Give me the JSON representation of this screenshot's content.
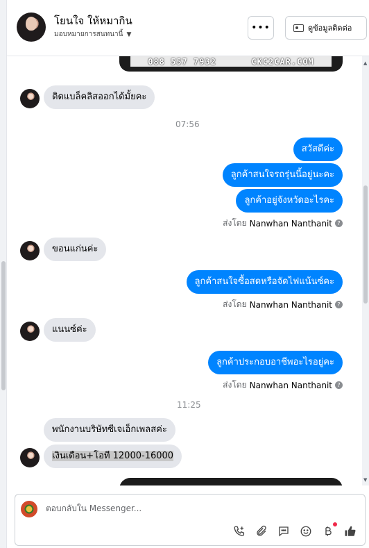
{
  "header": {
    "title": "โยนใจ ให้หมากิน",
    "subtitle": "มอบหมายการสนทนานี้",
    "more_label": "•••",
    "contact_label": "ดูข้อมูลติดต่อ"
  },
  "image_banner": {
    "phone": "088 557 7932",
    "site": "CKC2CAR.COM"
  },
  "messages": [
    {
      "type": "in",
      "text": "ติดแบล็คลิสออกได้มั้ยคะ"
    },
    {
      "type": "time",
      "text": "07:56"
    },
    {
      "type": "out",
      "text": "สวัสดีค่ะ"
    },
    {
      "type": "out",
      "text": "ลูกค้าสนใจรถรุ่นนี้อยู่นะคะ"
    },
    {
      "type": "out",
      "text": "ลูกค้าอยู่จังหวัดอะไรคะ"
    },
    {
      "type": "sent_by",
      "prefix": "ส่งโดย",
      "name": "Nanwhan Nanthanit"
    },
    {
      "type": "in",
      "text": "ขอนแก่นค่ะ"
    },
    {
      "type": "out",
      "text": "ลูกค้าสนใจซื้อสดหรือจัดไฟแน้นซ์คะ"
    },
    {
      "type": "sent_by",
      "prefix": "ส่งโดย",
      "name": "Nanwhan Nanthanit"
    },
    {
      "type": "in",
      "text": "แนนซ์ค่ะ"
    },
    {
      "type": "out",
      "text": "ลูกค้าประกอบอาชีพอะไรอยู่คะ"
    },
    {
      "type": "sent_by",
      "prefix": "ส่งโดย",
      "name": "Nanwhan Nanthanit"
    },
    {
      "type": "time",
      "text": "11:25"
    },
    {
      "type": "in",
      "text": "พนักงานบริษัทซีเจเอ็กเพลสค่ะ"
    },
    {
      "type": "in",
      "text": "เงินเดือน+โอที 12000-16000"
    }
  ],
  "composer": {
    "placeholder": "ตอบกลับใน Messenger...",
    "tools": [
      "call-plus-icon",
      "paperclip-icon",
      "speech-bubble-icon",
      "emoji-icon",
      "baht-icon",
      "thumbs-up-icon"
    ]
  },
  "colors": {
    "outgoing_bubble": "#0084ff",
    "incoming_bubble": "#e4e6eb",
    "notification_dot": "#f02849"
  }
}
